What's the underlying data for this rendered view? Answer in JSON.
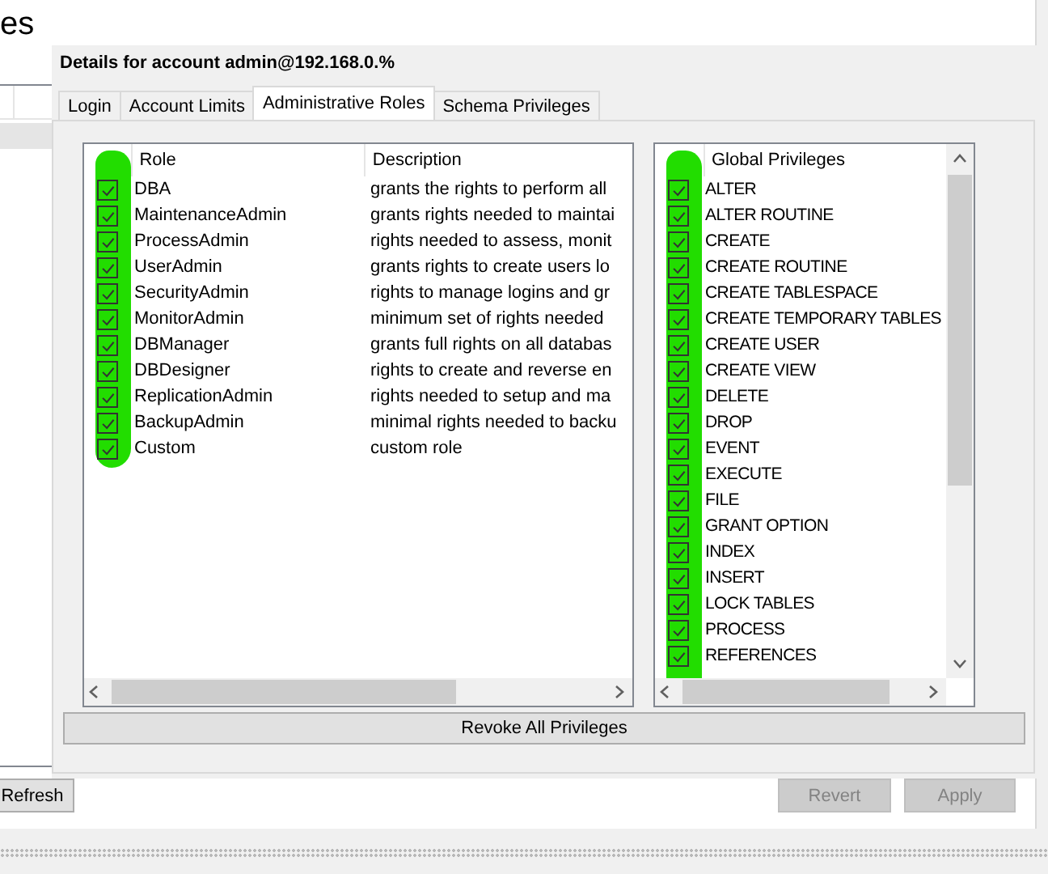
{
  "page_title": "es",
  "details": {
    "title": "Details for account admin@192.168.0.%",
    "tabs": [
      {
        "label": "Login",
        "selected": false
      },
      {
        "label": "Account Limits",
        "selected": false
      },
      {
        "label": "Administrative Roles",
        "selected": true
      },
      {
        "label": "Schema Privileges",
        "selected": false
      }
    ],
    "roles": {
      "columns": [
        "Role",
        "Description"
      ],
      "rows": [
        {
          "role": "DBA",
          "description": "grants the rights to perform all",
          "checked": true
        },
        {
          "role": "MaintenanceAdmin",
          "description": "grants rights needed to maintai",
          "checked": true
        },
        {
          "role": "ProcessAdmin",
          "description": "rights needed to assess, monit",
          "checked": true
        },
        {
          "role": "UserAdmin",
          "description": "grants rights to create users lo",
          "checked": true
        },
        {
          "role": "SecurityAdmin",
          "description": "rights to manage logins and gr",
          "checked": true
        },
        {
          "role": "MonitorAdmin",
          "description": "minimum set of rights needed",
          "checked": true
        },
        {
          "role": "DBManager",
          "description": "grants full rights on all databas",
          "checked": true
        },
        {
          "role": "DBDesigner",
          "description": "rights to create and reverse en",
          "checked": true
        },
        {
          "role": "ReplicationAdmin",
          "description": "rights needed to setup and ma",
          "checked": true
        },
        {
          "role": "BackupAdmin",
          "description": "minimal rights needed to backu",
          "checked": true
        },
        {
          "role": "Custom",
          "description": "custom role",
          "checked": true
        }
      ]
    },
    "privileges": {
      "column": "Global Privileges",
      "rows": [
        {
          "name": "ALTER",
          "checked": true
        },
        {
          "name": "ALTER ROUTINE",
          "checked": true
        },
        {
          "name": "CREATE",
          "checked": true
        },
        {
          "name": "CREATE ROUTINE",
          "checked": true
        },
        {
          "name": "CREATE TABLESPACE",
          "checked": true
        },
        {
          "name": "CREATE TEMPORARY TABLES",
          "checked": true
        },
        {
          "name": "CREATE USER",
          "checked": true
        },
        {
          "name": "CREATE VIEW",
          "checked": true
        },
        {
          "name": "DELETE",
          "checked": true
        },
        {
          "name": "DROP",
          "checked": true
        },
        {
          "name": "EVENT",
          "checked": true
        },
        {
          "name": "EXECUTE",
          "checked": true
        },
        {
          "name": "FILE",
          "checked": true
        },
        {
          "name": "GRANT OPTION",
          "checked": true
        },
        {
          "name": "INDEX",
          "checked": true
        },
        {
          "name": "INSERT",
          "checked": true
        },
        {
          "name": "LOCK TABLES",
          "checked": true
        },
        {
          "name": "PROCESS",
          "checked": true
        },
        {
          "name": "REFERENCES",
          "checked": true
        }
      ]
    },
    "revoke_button": "Revoke All Privileges"
  },
  "buttons": [
    {
      "label": "Refresh",
      "disabled": false
    },
    {
      "label": "Revert",
      "disabled": true
    },
    {
      "label": "Apply",
      "disabled": true
    }
  ]
}
